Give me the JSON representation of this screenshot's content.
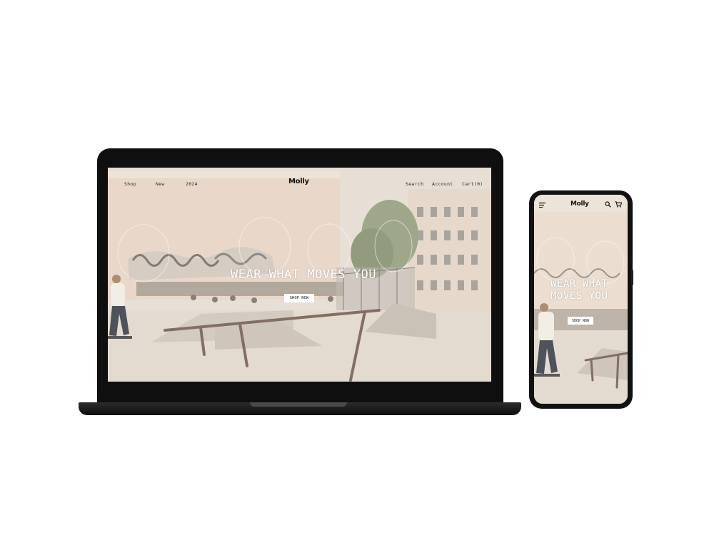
{
  "desktop": {
    "nav_left": [
      "Shop",
      "New",
      "2024"
    ],
    "brand": "Molly",
    "nav_right": [
      "Search",
      "Account",
      "Cart"
    ],
    "cart_count": "(0)",
    "hero_title": "WEAR WHAT MOVES YOU",
    "cta_label": "SHOP NOW"
  },
  "mobile": {
    "brand": "Molly",
    "hero_title_line1": "WEAR WHAT",
    "hero_title_line2": "MOVES YOU",
    "cta_label": "SHOP NOW",
    "icons": [
      "menu-icon",
      "search-icon",
      "cart-icon"
    ]
  },
  "colors": {
    "device_frame": "#0f0f10",
    "hero_tint": "#e9ded2",
    "cta_background": "#ffffff",
    "hero_text": "#ffffff"
  }
}
